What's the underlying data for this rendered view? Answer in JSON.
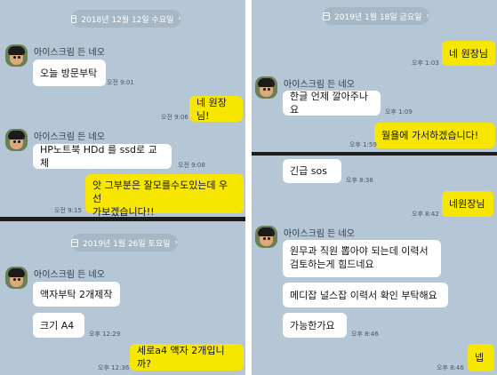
{
  "panels": {
    "top_left": {
      "date_label": "2018년 12월 12일 수요일",
      "sender": "아이스크림 든 네오",
      "messages": [
        {
          "text": "오늘 방문부탁",
          "time": "오전 9:01"
        },
        {
          "text": "네 원장님!",
          "time": "오전 9:06"
        },
        {
          "text": "HP노트북 HDd 를 ssd로 교체",
          "time": "오전 9:08"
        },
        {
          "line1": "앗 그부분은 잘모를수도있는데 우선",
          "line2": "가보겠습니다!!",
          "time": "오전 9:15"
        }
      ]
    },
    "bottom_left": {
      "date_label": "2019년 1월 26일 토요일",
      "sender": "아이스크림 든 네오",
      "messages": [
        {
          "text": "액자부탁 2개제작",
          "time": ""
        },
        {
          "text": "크기 A4",
          "time": "오후 12:29"
        },
        {
          "text": "세로a4 액자 2개입니까?",
          "time": "오후 12:36"
        }
      ]
    },
    "top_right": {
      "date_label": "2019년 1월 18일 금요일",
      "sender": "아이스크림 든 네오",
      "messages": [
        {
          "text": "네 원장님",
          "time": "오후 1:03"
        },
        {
          "text": "한글 언제 깔아주나요",
          "time": "오후 1:09"
        },
        {
          "text": "월욜에 가서하겠습니다!",
          "time": "오후 1:59"
        }
      ]
    },
    "bottom_right": {
      "sender": "아이스크림 든 네오",
      "messages": [
        {
          "text": "긴급 sos",
          "time": "오후 8:38"
        },
        {
          "text": "네원장님",
          "time": "오후 8:42"
        },
        {
          "line1": "원무과 직원 뽑아야 되는데 이력서",
          "line2": "검토하는게  힘드네요",
          "time": ""
        },
        {
          "text": "메디잡 널스잡  이력서 확인 부탁해요",
          "time": ""
        },
        {
          "text": "가능한가요",
          "time": "오후 8:46"
        },
        {
          "text": "넵",
          "time": "오후 8:46"
        }
      ]
    }
  },
  "icons": {
    "calendar": "calendar-icon",
    "chevron": "chevron-right-icon",
    "avatar": "neo-avatar-icon"
  },
  "colors": {
    "chat_background": "#b5c7d6",
    "incoming_bubble": "#ffffff",
    "outgoing_bubble": "#f7e600",
    "divider": "#1c1c1c"
  }
}
